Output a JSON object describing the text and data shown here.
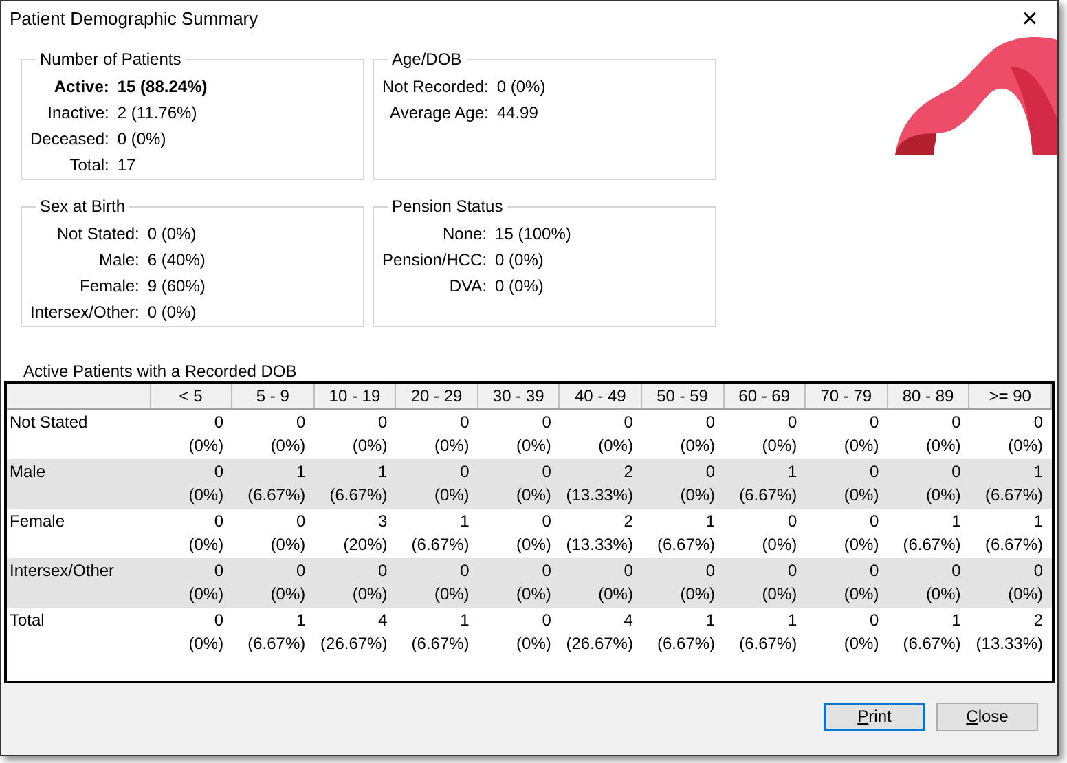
{
  "window": {
    "title": "Patient Demographic Summary",
    "close": "×"
  },
  "groups": [
    {
      "title": "Number of Patients",
      "rows": [
        {
          "label": "Active:",
          "value": "15 (88.24%)",
          "emphasized": true
        },
        {
          "label": "Inactive:",
          "value": "2 (11.76%)",
          "emphasized": false
        },
        {
          "label": "Deceased:",
          "value": "0 (0%)",
          "emphasized": false
        },
        {
          "label": "Total:",
          "value": "17",
          "emphasized": false
        }
      ]
    },
    {
      "title": "Age/DOB",
      "rows": [
        {
          "label": "Not Recorded:",
          "value": "0 (0%)",
          "emphasized": false
        },
        {
          "label": "Average Age:",
          "value": "44.99",
          "emphasized": false
        }
      ]
    },
    {
      "title": "Sex at Birth",
      "rows": [
        {
          "label": "Not Stated:",
          "value": "0 (0%)",
          "emphasized": false
        },
        {
          "label": "Male:",
          "value": "6 (40%)",
          "emphasized": false
        },
        {
          "label": "Female:",
          "value": "9 (60%)",
          "emphasized": false
        },
        {
          "label": "Intersex/Other:",
          "value": "0 (0%)",
          "emphasized": false
        }
      ]
    },
    {
      "title": "Pension Status",
      "rows": [
        {
          "label": "None:",
          "value": "15 (100%)",
          "emphasized": false
        },
        {
          "label": "Pension/HCC:",
          "value": "0 (0%)",
          "emphasized": false
        },
        {
          "label": "DVA:",
          "value": "0 (0%)",
          "emphasized": false
        }
      ]
    }
  ],
  "table": {
    "title": "Active Patients with a Recorded DOB",
    "columns": [
      "< 5",
      "5 - 9",
      "10 - 19",
      "20 - 29",
      "30 - 39",
      "40 - 49",
      "50 - 59",
      "60 - 69",
      "70 - 79",
      "80 - 89",
      ">= 90"
    ],
    "rows": [
      {
        "label": "Not Stated",
        "cells": [
          [
            "0",
            "(0%)"
          ],
          [
            "0",
            "(0%)"
          ],
          [
            "0",
            "(0%)"
          ],
          [
            "0",
            "(0%)"
          ],
          [
            "0",
            "(0%)"
          ],
          [
            "0",
            "(0%)"
          ],
          [
            "0",
            "(0%)"
          ],
          [
            "0",
            "(0%)"
          ],
          [
            "0",
            "(0%)"
          ],
          [
            "0",
            "(0%)"
          ],
          [
            "0",
            "(0%)"
          ]
        ]
      },
      {
        "label": "Male",
        "cells": [
          [
            "0",
            "(0%)"
          ],
          [
            "1",
            "(6.67%)"
          ],
          [
            "1",
            "(6.67%)"
          ],
          [
            "0",
            "(0%)"
          ],
          [
            "0",
            "(0%)"
          ],
          [
            "2",
            "(13.33%)"
          ],
          [
            "0",
            "(0%)"
          ],
          [
            "1",
            "(6.67%)"
          ],
          [
            "0",
            "(0%)"
          ],
          [
            "0",
            "(0%)"
          ],
          [
            "1",
            "(6.67%)"
          ]
        ]
      },
      {
        "label": "Female",
        "cells": [
          [
            "0",
            "(0%)"
          ],
          [
            "0",
            "(0%)"
          ],
          [
            "3",
            "(20%)"
          ],
          [
            "1",
            "(6.67%)"
          ],
          [
            "0",
            "(0%)"
          ],
          [
            "2",
            "(13.33%)"
          ],
          [
            "1",
            "(6.67%)"
          ],
          [
            "0",
            "(0%)"
          ],
          [
            "0",
            "(0%)"
          ],
          [
            "1",
            "(6.67%)"
          ],
          [
            "1",
            "(6.67%)"
          ]
        ]
      },
      {
        "label": "Intersex/Other",
        "cells": [
          [
            "0",
            "(0%)"
          ],
          [
            "0",
            "(0%)"
          ],
          [
            "0",
            "(0%)"
          ],
          [
            "0",
            "(0%)"
          ],
          [
            "0",
            "(0%)"
          ],
          [
            "0",
            "(0%)"
          ],
          [
            "0",
            "(0%)"
          ],
          [
            "0",
            "(0%)"
          ],
          [
            "0",
            "(0%)"
          ],
          [
            "0",
            "(0%)"
          ],
          [
            "0",
            "(0%)"
          ]
        ]
      },
      {
        "label": "Total",
        "cells": [
          [
            "0",
            "(0%)"
          ],
          [
            "1",
            "(6.67%)"
          ],
          [
            "4",
            "(26.67%)"
          ],
          [
            "1",
            "(6.67%)"
          ],
          [
            "0",
            "(0%)"
          ],
          [
            "4",
            "(26.67%)"
          ],
          [
            "1",
            "(6.67%)"
          ],
          [
            "1",
            "(6.67%)"
          ],
          [
            "0",
            "(0%)"
          ],
          [
            "1",
            "(6.67%)"
          ],
          [
            "2",
            "(13.33%)"
          ]
        ]
      }
    ]
  },
  "buttons": [
    {
      "label": "Print",
      "default": true
    },
    {
      "label": "Close",
      "default": false
    }
  ]
}
